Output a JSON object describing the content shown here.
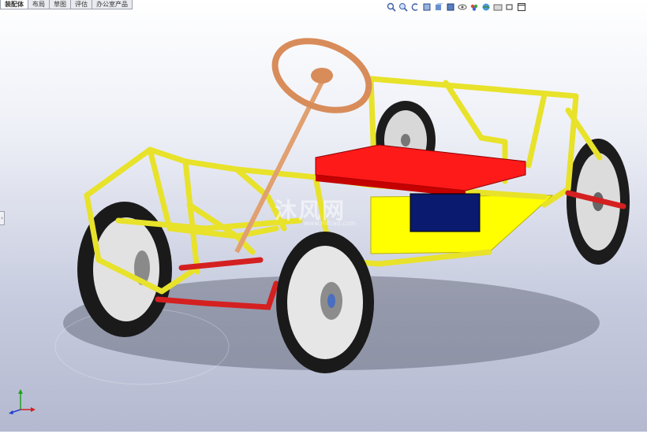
{
  "tabs": [
    {
      "label": "装配体",
      "active": true
    },
    {
      "label": "布局",
      "active": false
    },
    {
      "label": "草图",
      "active": false
    },
    {
      "label": "评估",
      "active": false
    },
    {
      "label": "办公室产品",
      "active": false
    }
  ],
  "hud_icons": [
    "zoom-to-fit-icon",
    "zoom-area-icon",
    "previous-view-icon",
    "section-view-icon",
    "view-orientation-icon",
    "display-style-icon",
    "hide-show-icon",
    "edit-appearance-icon",
    "apply-scene-icon",
    "view-settings-icon",
    "restore-icon",
    "maximize-icon"
  ],
  "watermark": {
    "text": "沐风网",
    "sub": "www.mfcad.com"
  },
  "colors": {
    "frame": "#e8e22a",
    "seat": "#ff1a1a",
    "battery": "#0a1a6e",
    "steering": "#e0a070",
    "axle": "#d42020",
    "tire": "#202020"
  }
}
